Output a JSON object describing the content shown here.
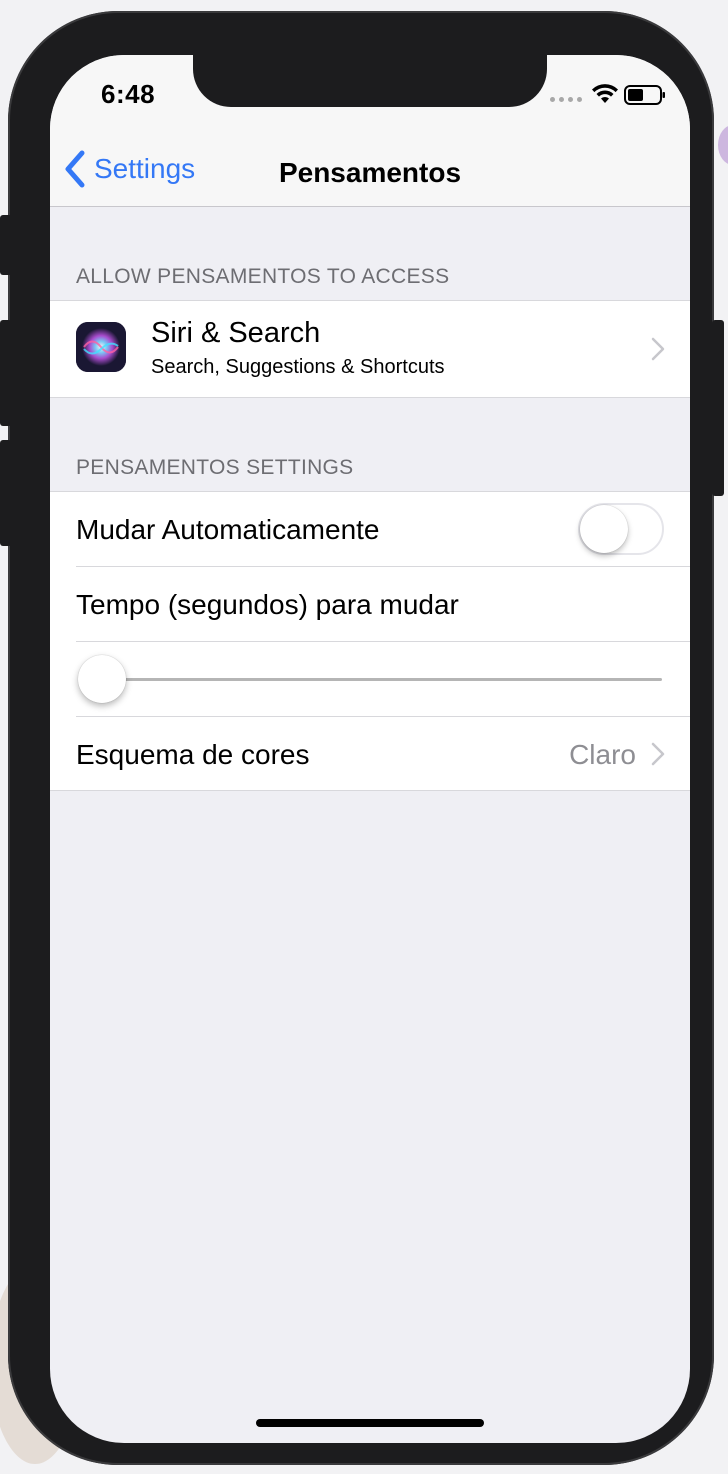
{
  "status_bar": {
    "time": "6:48"
  },
  "nav": {
    "back_label": "Settings",
    "title": "Pensamentos"
  },
  "access_section": {
    "header": "ALLOW PENSAMENTOS TO ACCESS",
    "siri": {
      "title": "Siri & Search",
      "subtitle": "Search, Suggestions & Shortcuts"
    }
  },
  "settings_section": {
    "header": "PENSAMENTOS SETTINGS",
    "auto_change": {
      "label": "Mudar Automaticamente",
      "enabled": false
    },
    "time_setting": {
      "label": "Tempo (segundos) para mudar",
      "slider_fraction": 0.0
    },
    "color_scheme": {
      "label": "Esquema de cores",
      "value": "Claro"
    }
  },
  "colors": {
    "accent": "#3478f6",
    "background": "#efeff4",
    "secondary_text": "#6d6d72"
  }
}
